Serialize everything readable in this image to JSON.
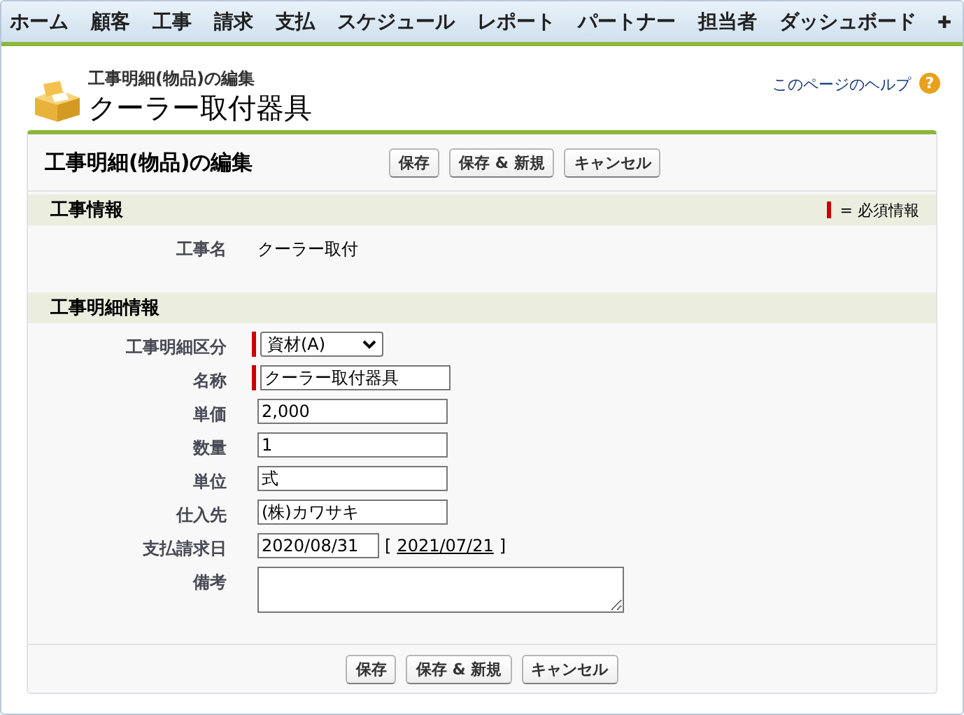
{
  "tabs": [
    {
      "label": "ホーム",
      "selected": false
    },
    {
      "label": "顧客",
      "selected": false
    },
    {
      "label": "工事",
      "selected": false
    },
    {
      "label": "請求",
      "selected": false
    },
    {
      "label": "支払",
      "selected": false
    },
    {
      "label": "スケジュール",
      "selected": false
    },
    {
      "label": "レポート",
      "selected": false
    },
    {
      "label": "パートナー",
      "selected": false
    },
    {
      "label": "担当者",
      "selected": false
    },
    {
      "label": "ダッシュボード",
      "selected": false
    }
  ],
  "more_tab": "✚",
  "header": {
    "subtitle": "工事明細(物品)の編集",
    "title": "クーラー取付器具",
    "help_link": "このページのヘルプ",
    "help_icon": "?"
  },
  "panel": {
    "title": "工事明細(物品)の編集",
    "buttons": [
      "保存",
      "保存 & 新規",
      "キャンセル"
    ],
    "sections": [
      {
        "title": "工事情報",
        "legend": "= 必須情報",
        "fields": [
          {
            "kind": "output",
            "label": "工事名",
            "value": "クーラー取付",
            "required": false
          }
        ]
      },
      {
        "title": "工事明細情報",
        "fields": [
          {
            "kind": "select",
            "label": "工事明細区分",
            "value": "資材(A)",
            "required": true
          },
          {
            "kind": "text",
            "label": "名称",
            "value": "クーラー取付器具",
            "required": true
          },
          {
            "kind": "text",
            "label": "単価",
            "value": "2,000",
            "required": false
          },
          {
            "kind": "text",
            "label": "数量",
            "value": "1",
            "required": false
          },
          {
            "kind": "text",
            "label": "単位",
            "value": "式",
            "required": false
          },
          {
            "kind": "text",
            "label": "仕入先",
            "value": "(株)カワサキ",
            "required": false
          },
          {
            "kind": "date",
            "label": "支払請求日",
            "value": "2020/08/31",
            "required": false,
            "today": {
              "open": "[",
              "label": "2021/07/21",
              "close": "]"
            }
          },
          {
            "kind": "textarea",
            "label": "備考",
            "required": false
          }
        ]
      }
    ],
    "bottom_buttons": [
      "保存",
      "保存 & 新規",
      "キャンセル"
    ]
  }
}
